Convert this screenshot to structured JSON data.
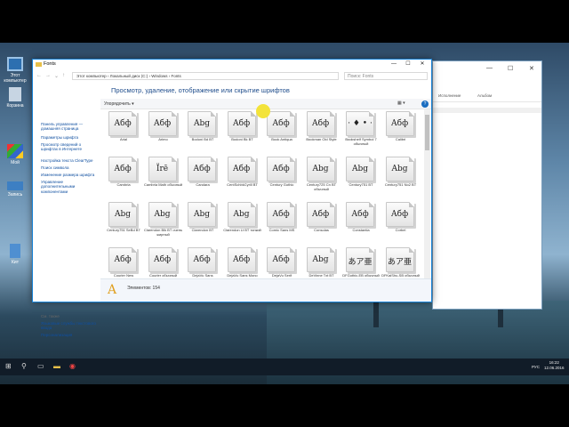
{
  "colors": {
    "accent": "#1883d7",
    "link": "#0f4fa0",
    "heading": "#1f4d8c",
    "taskbar": "#111c28"
  },
  "desktop": {
    "icons": [
      {
        "label": "Этот компьютер",
        "icon": "computer-icon"
      },
      {
        "label": "Корзина",
        "icon": "recycle-bin-icon"
      },
      {
        "label": "Мой",
        "icon": "app-icon"
      },
      {
        "label": "Запись",
        "icon": "drive-icon"
      },
      {
        "label": "Кит",
        "icon": "file-icon"
      }
    ]
  },
  "bg_window": {
    "cols": [
      "Исполнение",
      "Альбом"
    ]
  },
  "window": {
    "title": "Fonts",
    "controls": {
      "min": "—",
      "max": "☐",
      "close": "✕"
    },
    "address": "Этот компьютер  ›  Локальный диск (C:)  ›  Windows  ›  Fonts",
    "search_placeholder": "Поиск: Fonts",
    "left_panel": {
      "links": [
        "Панель управления — домашняя страница",
        "Параметры шрифта",
        "Просмотр сведений о шрифтах в Интернете",
        "Настройка текста ClearType",
        "Поиск символа",
        "Изменение размера шрифта",
        "Управление дополнительными компонентами"
      ],
      "see_also_title": "См. также",
      "see_also": [
        "Языковые службы текстового ввода",
        "Персонализация"
      ]
    },
    "heading": "Просмотр, удаление, отображение или скрытие шрифтов",
    "organize": "Упорядочить ▾",
    "view_icon": "view-icon",
    "help": "?",
    "fonts": [
      {
        "name": "Arial",
        "sample": "Абф"
      },
      {
        "name": "Arimo",
        "sample": "Абф"
      },
      {
        "name": "Bodoni Bd BT",
        "sample": "Abg"
      },
      {
        "name": "Bodoni Bk BT",
        "sample": "Абф"
      },
      {
        "name": "Book Antiqua",
        "sample": "Абф"
      },
      {
        "name": "Bookman Old Style",
        "sample": "Абф"
      },
      {
        "name": "Bookshelf Symbol 7 обычный",
        "sample": "· ♦ • ·"
      },
      {
        "name": "Calibri",
        "sample": "Абф"
      },
      {
        "name": "Cambria",
        "sample": "Абф"
      },
      {
        "name": "Cambria Math обычный",
        "sample": "Ïrē"
      },
      {
        "name": "Candara",
        "sample": "Абф"
      },
      {
        "name": "CentSchbkCyrill BT",
        "sample": "Абф"
      },
      {
        "name": "Century Gothic",
        "sample": "Абф"
      },
      {
        "name": "Century725 Cn BT обычный",
        "sample": "Abg"
      },
      {
        "name": "Century751 BT",
        "sample": "Abg"
      },
      {
        "name": "Century751 No2 BT",
        "sample": "Abg"
      },
      {
        "name": "Century751 SeBd BT",
        "sample": "Abg"
      },
      {
        "name": "Clarendon Blk BT очень жирный",
        "sample": "Abg"
      },
      {
        "name": "Clarendon BT",
        "sample": "Abg"
      },
      {
        "name": "Clarendon Lt BT тонкий",
        "sample": "Abg"
      },
      {
        "name": "Comic Sans MS",
        "sample": "Абф"
      },
      {
        "name": "Consolas",
        "sample": "Абф"
      },
      {
        "name": "Constantia",
        "sample": "Абф"
      },
      {
        "name": "Corbel",
        "sample": "Абф"
      },
      {
        "name": "Courier New",
        "sample": "Абф"
      },
      {
        "name": "Courier обычный",
        "sample": "Абф"
      },
      {
        "name": "DejaVu Sans",
        "sample": "Абф"
      },
      {
        "name": "DejaVu Sans Mono",
        "sample": "Абф"
      },
      {
        "name": "DejaVu Serif",
        "sample": "Абф"
      },
      {
        "name": "DeVinne Txt BT обычный",
        "sample": "Abg"
      },
      {
        "name": "DFGothic-EB обычный",
        "sample": "あア亜"
      },
      {
        "name": "DFKaiShu-SB обычный",
        "sample": "あア亜"
      }
    ],
    "details_count": "Элементов: 154",
    "details_glyph": "A"
  },
  "taskbar": {
    "items": [
      "start-icon",
      "search-icon",
      "task-view-icon",
      "explorer-icon",
      "chrome-icon"
    ],
    "lang": "РУС",
    "time": "16:22",
    "date": "12.06.2016"
  }
}
